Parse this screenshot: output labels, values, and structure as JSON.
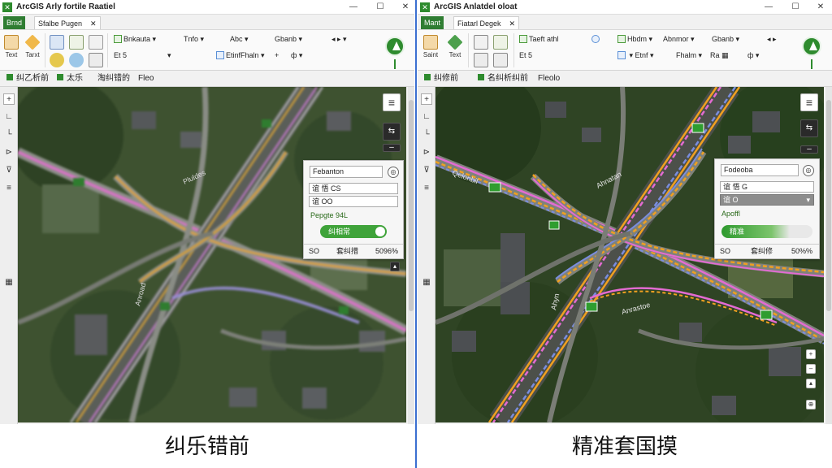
{
  "colors": {
    "accent": "#2e8b2e",
    "divider": "#3b6fd0",
    "route_pink": "#e36bd2",
    "route_orange": "#f0a020",
    "route_blue": "#7a8de0"
  },
  "left": {
    "app_title": "ArcGIS Arly fortile Raatiel",
    "window_controls": [
      "—",
      "☐",
      "✕"
    ],
    "tabs": {
      "file": "Brnd",
      "active": "Sfalbe Pugen"
    },
    "ribbon": {
      "buttons": [
        {
          "label": "Text"
        },
        {
          "label": "Tarxt"
        }
      ],
      "row1": [
        "Bnkauta",
        "Tnfo",
        "Abc",
        "Gbanb"
      ],
      "row2": [
        "Etinf",
        "Fhaln",
        "+",
        "ф"
      ],
      "row2_extra": "Et 5"
    },
    "layerbar": [
      "纠乙析前",
      "太乐",
      "淘纠错的",
      "Fleo"
    ],
    "floatpanel": {
      "search": "Febanton",
      "line1": "谊 悟 CS",
      "line2": "谊 OO",
      "label": "Pepgte 94L",
      "toggle": "纠相常",
      "footer": [
        "SO",
        "套纠措",
        "5096%"
      ]
    },
    "map_labels": [
      "Anroad",
      "Pluldes"
    ],
    "caption": "纠乐错前"
  },
  "right": {
    "app_title": "ArcGIS Anlatdel oloat",
    "window_controls": [
      "—",
      "☐",
      "✕"
    ],
    "tabs": {
      "file": "Mant",
      "active": "Fiatarl Degek"
    },
    "ribbon": {
      "buttons": [
        {
          "label": "Saint"
        },
        {
          "label": "Text"
        }
      ],
      "row1": [
        "Taeft athl",
        "Hbdm",
        "Abnmor",
        "Gbanb"
      ],
      "row2": [
        "Etnf",
        "Fhalm",
        "Ra",
        "ф"
      ],
      "row2_extra": "Et 5"
    },
    "layerbar": [
      "纠修前",
      "名纠析纠前",
      "Fleolo"
    ],
    "floatpanel": {
      "search": "Fodeoba",
      "line1": "谊 悟 G",
      "line2": "谊 O",
      "label": "Apoffl",
      "toggle": "精准",
      "footer": [
        "SO",
        "套纠修",
        "50%%"
      ]
    },
    "map_labels": [
      "Qelonbil",
      "Ahnatan",
      "Ahyn",
      "Anrastoe"
    ],
    "caption": "精准套国摸"
  }
}
